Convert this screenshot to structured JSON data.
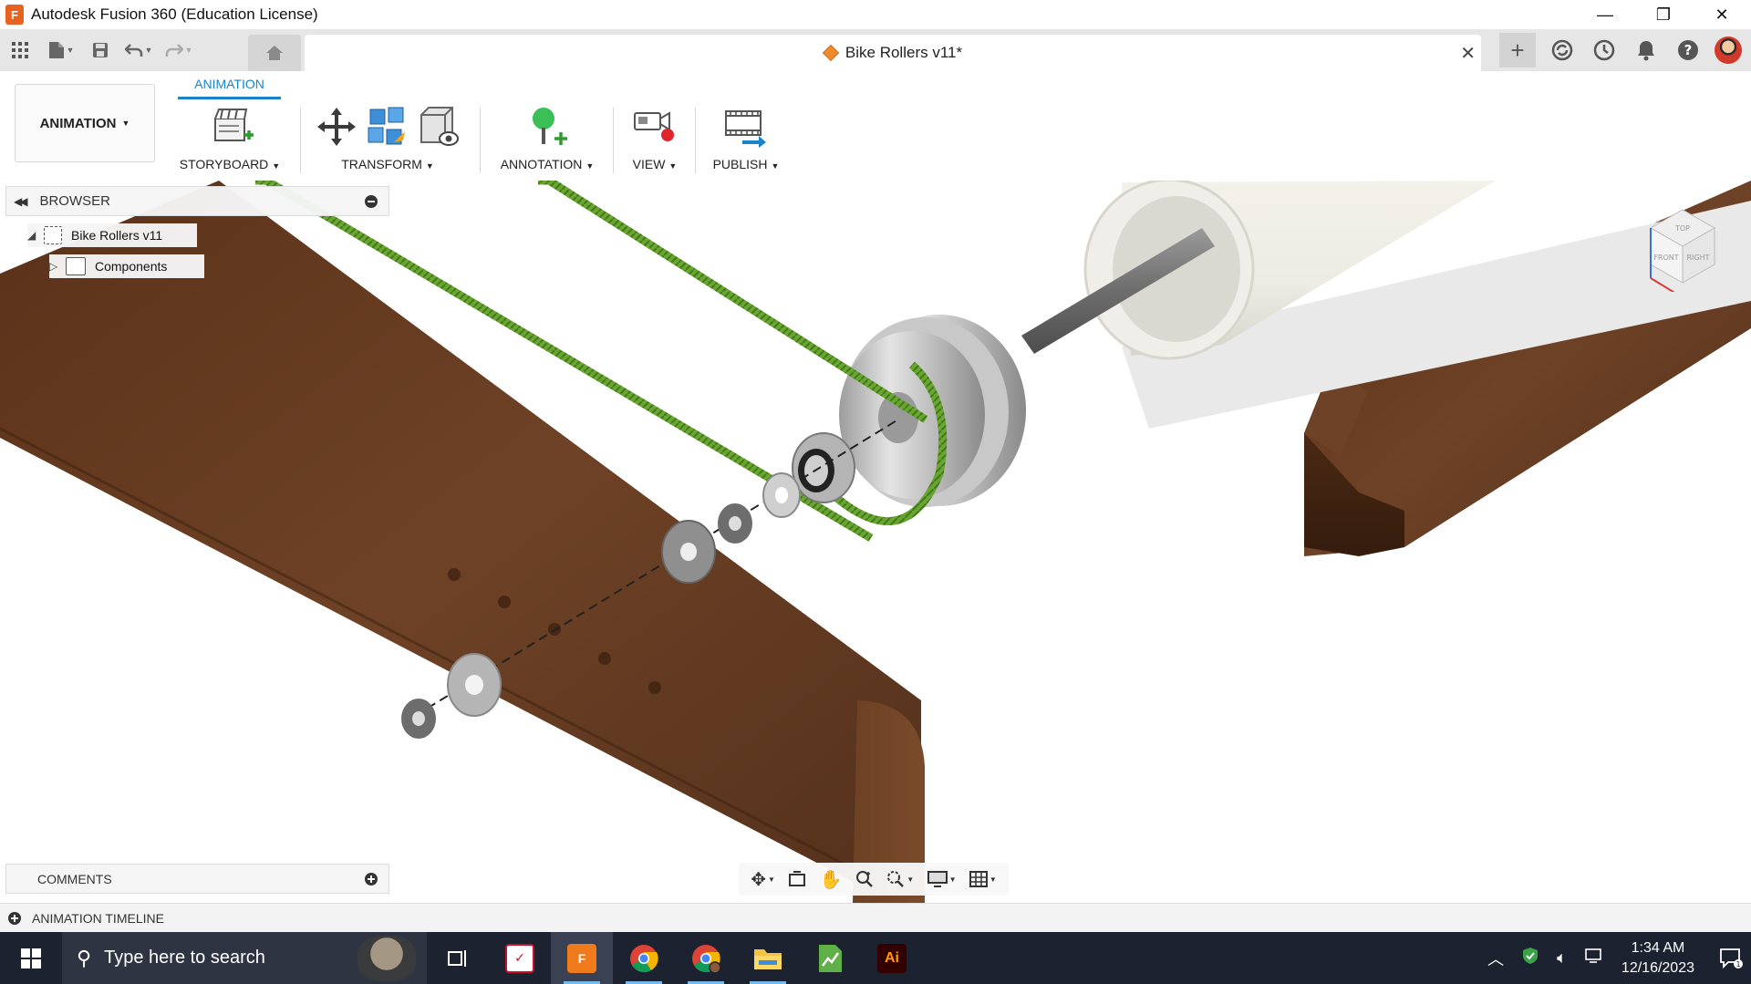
{
  "window": {
    "title": "Autodesk Fusion 360 (Education License)",
    "controls": {
      "minimize": "—",
      "restore": "❐",
      "close": "✕"
    }
  },
  "appbar": {
    "doc_tab_label": "Bike Rollers v11*",
    "close_glyph": "✕",
    "new_tab_glyph": "+"
  },
  "ribbon": {
    "workspace_label": "ANIMATION",
    "active_tab": "ANIMATION",
    "groups": [
      {
        "label": "STORYBOARD",
        "icon": "storyboard-icon"
      },
      {
        "label": "TRANSFORM",
        "icon": "transform-icon"
      },
      {
        "label": "ANNOTATION",
        "icon": "annotation-icon"
      },
      {
        "label": "VIEW",
        "icon": "view-icon"
      },
      {
        "label": "PUBLISH",
        "icon": "publish-icon"
      }
    ]
  },
  "browser": {
    "title": "BROWSER",
    "root_label": "Bike Rollers v11",
    "child_label": "Components"
  },
  "comments": {
    "title": "COMMENTS"
  },
  "timeline": {
    "title": "ANIMATION TIMELINE"
  },
  "viewcube": {
    "top": "TOP",
    "front": "FRONT",
    "right": "RIGHT"
  },
  "taskbar": {
    "search_placeholder": "Type here to search",
    "time": "1:34 AM",
    "date": "12/16/2023",
    "notification_count": "1",
    "apps": [
      "task-view",
      "vectorworks",
      "fusion-360",
      "chrome",
      "chrome-profile",
      "file-explorer",
      "sheets",
      "illustrator"
    ],
    "fusion_label": "F",
    "illustrator_label": "Ai"
  },
  "colors": {
    "accent": "#1a82c9",
    "wood": "#6b4024",
    "belt": "#6aa532",
    "taskbar": "#1c2230"
  }
}
